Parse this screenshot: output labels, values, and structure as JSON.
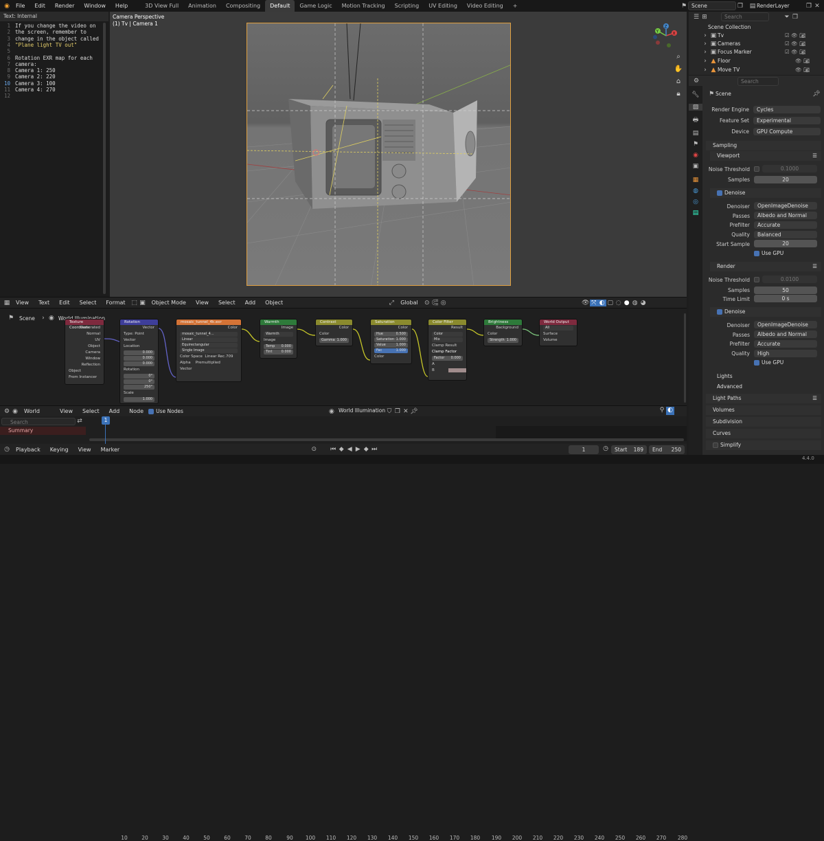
{
  "menu": [
    "File",
    "Edit",
    "Render",
    "Window",
    "Help"
  ],
  "workspaces": [
    "3D View Full",
    "Animation",
    "Compositing",
    "Default",
    "Game Logic",
    "Motion Tracking",
    "Scripting",
    "UV Editing",
    "Video Editing",
    "+"
  ],
  "active_workspace": "Default",
  "scene_field": "Scene",
  "view_layer_field": "RenderLayer",
  "text_editor": {
    "header": "Text: Internal",
    "lines": [
      {
        "n": "1",
        "t": "If you change the video on"
      },
      {
        "n": "2",
        "t": "the screen, remember to"
      },
      {
        "n": "3",
        "t": "change in the object called"
      },
      {
        "n": "4",
        "t": "\"Plane light TV out\""
      },
      {
        "n": "5",
        "t": ""
      },
      {
        "n": "6",
        "t": "Rotation EXR map for each"
      },
      {
        "n": "7",
        "t": "camera:"
      },
      {
        "n": "8",
        "t": "Camera 1: 250"
      },
      {
        "n": "9",
        "t": "Camera 2: 220"
      },
      {
        "n": "10",
        "t": "Camera 3: 100"
      },
      {
        "n": "11",
        "t": "Camera 4: 270"
      },
      {
        "n": "12",
        "t": ""
      }
    ]
  },
  "viewport": {
    "title": "Camera Perspective",
    "subtitle": "(1) Tv | Camera 1",
    "axis_labels": [
      "X",
      "Y",
      "Z"
    ]
  },
  "viewport_bar": {
    "text_menu": [
      "View",
      "Text",
      "Edit",
      "Select",
      "Format"
    ],
    "mode": "Object Mode",
    "menu": [
      "View",
      "Select",
      "Add",
      "Object"
    ],
    "orientation": "Global"
  },
  "node_editor": {
    "breadcrumb": [
      "Scene",
      "World Illumination"
    ],
    "nodes": {
      "texcoord": {
        "title": "Texture Coordinate",
        "outputs": [
          "Generated",
          "Normal",
          "UV",
          "Object",
          "Camera",
          "Window",
          "Reflection"
        ],
        "object_label": "Object",
        "from_instancer": "From Instancer"
      },
      "rotation": {
        "title": "Rotation",
        "output": "Vector",
        "type_label": "Type:",
        "type_value": "Point",
        "vector": "Vector",
        "location": "Location",
        "loc": [
          "0.000",
          "0.000",
          "0.000"
        ],
        "rotation": "Rotation",
        "rot": [
          "0°",
          "0°",
          "250°"
        ],
        "scale": "Scale",
        "scale_val": "1.000"
      },
      "envtex": {
        "title": "mosaic_tunnel_4k.exr",
        "output": "Color",
        "file": "mosaic_tunnel_4...",
        "interp": "Linear",
        "proj": "Equirectangular",
        "src": "Single Image",
        "cs_label": "Color Space",
        "cs_value": "Linear Rec.709",
        "alpha_label": "Alpha",
        "alpha_value": "Premultiplied",
        "vector": "Vector"
      },
      "warmth": {
        "title": "Warmth",
        "output": "Image",
        "mode": "Warmth",
        "input": "Image",
        "temp_label": "Temp",
        "temp": "0.000",
        "tint_label": "Tint",
        "tint": "0.000"
      },
      "contrast": {
        "title": "Contrast",
        "output": "Color",
        "input": "Color",
        "gamma_label": "Gamma",
        "gamma": "1.000"
      },
      "saturation": {
        "title": "Saturation",
        "output": "Color",
        "hue_label": "Hue",
        "hue": "0.500",
        "sat_label": "Saturation",
        "sat": "1.000",
        "val_label": "Value",
        "val": "1.000",
        "fac_label": "Fac",
        "fac": "1.000",
        "input": "Color"
      },
      "colorfilter": {
        "title": "Color Filter",
        "output": "Result",
        "dd1": "Color",
        "dd2": "Mix",
        "clamp_result": "Clamp Result",
        "clamp_factor": "Clamp Factor",
        "factor_label": "Factor",
        "factor": "0.000",
        "a": "A",
        "b": "B"
      },
      "brightness": {
        "title": "Brightness",
        "output": "Background",
        "input": "Color",
        "strength_label": "Strength",
        "strength": "1.000"
      },
      "worldout": {
        "title": "World Output",
        "target": "All",
        "surface": "Surface",
        "volume": "Volume"
      }
    }
  },
  "node_bar": {
    "type": "World",
    "menu": [
      "View",
      "Select",
      "Add",
      "Node"
    ],
    "use_nodes": "Use Nodes",
    "world_name": "World Illumination"
  },
  "timeline": {
    "search_placeholder": "Search",
    "summary": "Summary",
    "ticks": [
      "10",
      "20",
      "30",
      "40",
      "50",
      "60",
      "70",
      "80",
      "90",
      "100",
      "110",
      "120",
      "130",
      "140",
      "150",
      "160",
      "170",
      "180",
      "190",
      "200",
      "210",
      "220",
      "230",
      "240",
      "250",
      "260",
      "270",
      "280"
    ],
    "current_frame": "1",
    "footer_menu": [
      "Playback",
      "Keying",
      "View",
      "Marker"
    ],
    "frame_field": "1",
    "start_label": "Start",
    "start": "189",
    "end_label": "End",
    "end": "250"
  },
  "version": "4.4.0",
  "outliner": {
    "search_placeholder": "Search",
    "root": "Scene Collection",
    "items": [
      "Tv",
      "Cameras",
      "Focus Marker",
      "Floor",
      "Move TV"
    ]
  },
  "properties": {
    "search_placeholder": "Search",
    "context": "Scene",
    "render_engine_label": "Render Engine",
    "render_engine": "Cycles",
    "feature_set_label": "Feature Set",
    "feature_set": "Experimental",
    "device_label": "Device",
    "device": "GPU Compute",
    "sampling": "Sampling",
    "viewport": "Viewport",
    "noise_threshold_label": "Noise Threshold",
    "vp_noise_threshold": "0.1000",
    "samples_label": "Samples",
    "vp_samples": "20",
    "denoise": "Denoise",
    "denoiser_label": "Denoiser",
    "vp_denoiser": "OpenImageDenoise",
    "passes_label": "Passes",
    "vp_passes": "Albedo and Normal",
    "prefilter_label": "Prefilter",
    "vp_prefilter": "Accurate",
    "quality_label": "Quality",
    "vp_quality": "Balanced",
    "start_sample_label": "Start Sample",
    "vp_start_sample": "20",
    "use_gpu": "Use GPU",
    "render": "Render",
    "r_noise_threshold": "0.0100",
    "r_samples": "50",
    "time_limit_label": "Time Limit",
    "r_time_limit": "0 s",
    "r_denoiser": "OpenImageDenoise",
    "r_passes": "Albedo and Normal",
    "r_prefilter": "Accurate",
    "r_quality": "High",
    "lights": "Lights",
    "advanced": "Advanced",
    "light_paths": "Light Paths",
    "volumes": "Volumes",
    "subdivision": "Subdivision",
    "curves": "Curves",
    "simplify": "Simplify"
  },
  "colors": {
    "accent": "#4772b3",
    "camera_frame": "#e0a040",
    "node_texture": "#d47336",
    "node_vector": "#3e3e9a",
    "node_color": "#8a8a2e",
    "node_output": "#7e2a3e",
    "node_shader": "#2e7a3a"
  }
}
